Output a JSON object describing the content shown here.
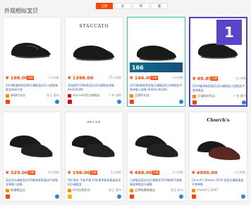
{
  "header": {
    "title": "外观相似宝贝",
    "tabs": [
      {
        "label": "全部",
        "active": true
      },
      {
        "label": "女",
        "active": false
      },
      {
        "label": "男",
        "active": false
      },
      {
        "label": "童",
        "active": false
      }
    ]
  },
  "badge": {
    "rank": "1"
  },
  "cards": [
    {
      "price": "¥ 168.00",
      "tag": "包邮",
      "sales": "1人付款",
      "desc": "2019新春新款女鞋乐福鞋英伦风小皮鞋单鞋女休闲平底",
      "shop": "新鞋时尚店",
      "loc": "浙江 温州",
      "shop_color": "#ff8a00",
      "bottom_icon_color": "#ff4400"
    },
    {
      "price": "¥ 1398.00",
      "tag": "",
      "sales": "27人付款",
      "desc": "思加图2019新款英伦风乐福鞋女皮鞋9H204CM9",
      "shop": "staccato官方旗舰店",
      "loc": "广东 深圳",
      "shop_color": "#e60012",
      "bottom_icon_color": "#e60012",
      "brand": "STACCATO"
    },
    {
      "price": "¥ 166.00",
      "tag": "包邮",
      "sales": "1人付款",
      "desc": "2019新春新款女鞋乐福鞋英伦风单鞋女平底单鞋小皮鞋 9H204 9H206",
      "shop": "品牌折扣店",
      "loc": "",
      "shop_color": "#ff8a00",
      "bottom_icon_color": "#ff4400",
      "promo": "166"
    },
    {
      "price": "¥ 89.85",
      "tag": "包邮",
      "sales": "1人付款",
      "desc": "2019春季新款英伦风乐福鞋女小皮鞋女平底单鞋女",
      "shop": "乐福鞋时尚店",
      "loc": "广东 惠州",
      "shop_color": "#ff8a00",
      "bottom_icon_color": "#ff4400"
    },
    {
      "price": "¥ 329.00",
      "tag": "包邮",
      "sales": "6人付款",
      "desc": "英伦风乐福鞋女2019春季新款真皮平底鞋女单鞋小皮鞋",
      "shop": "鞋履精品店",
      "loc": "",
      "shop_color": "#ff8a00",
      "bottom_icon_color": "#ff4400"
    },
    {
      "price": "¥ 198.00",
      "tag": "包邮",
      "sales": "1人付款",
      "desc": "特价清仓 不退不换 19年春季新款真皮英伦风乐福鞋女",
      "shop": "时尚女鞋折扣",
      "loc": "浙江 温州",
      "shop_color": "#ff8a00",
      "bottom_icon_color": "#ffb400",
      "brand": "BELLE"
    },
    {
      "price": "¥ 498.00",
      "tag": "包邮",
      "sales": "5人付款",
      "desc": "小皮鞋女英伦风乐福鞋女2019新款平底鞋真皮单鞋女乐福鞋",
      "shop": "品牌鞋履旗舰店",
      "loc": "浙江 杭州",
      "shop_color": "#ff8a00",
      "bottom_icon_color": "#ff4400"
    },
    {
      "price": "¥ 4950.00",
      "tag": "",
      "sales": "1人付款",
      "desc": "Church's Staden 2019 女款乐福鞋真皮平底单鞋",
      "shop": "church's_1017",
      "loc": "",
      "shop_color": "#ff8a00",
      "bottom_icon_color": "#ff4400",
      "brand": "Church's"
    }
  ],
  "colors": {
    "accent": "#ff4400",
    "selected_purple": "#5340c2",
    "selected_green": "#2ec4a6",
    "link_blue": "#3a5aa8"
  }
}
